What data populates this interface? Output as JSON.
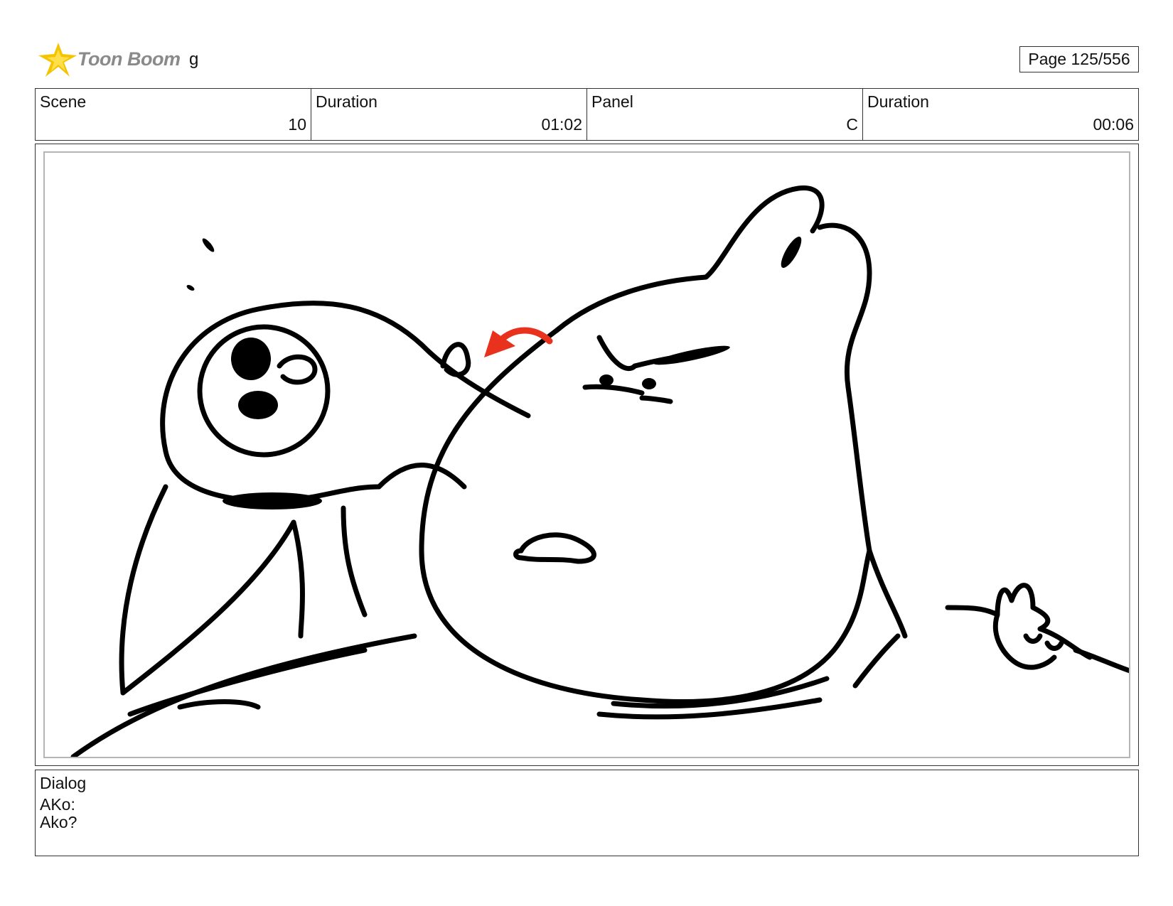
{
  "header": {
    "logo_text": "Toon Boom",
    "project_name": "g",
    "page_label": "Page 125/556"
  },
  "info": {
    "scene_label": "Scene",
    "scene_value": "10",
    "scene_duration_label": "Duration",
    "scene_duration_value": "01:02",
    "panel_label": "Panel",
    "panel_value": "C",
    "panel_duration_label": "Duration",
    "panel_duration_value": "00:06"
  },
  "dialog": {
    "label": "Dialog",
    "line1": "AKo:",
    "line2": "Ako?"
  },
  "colors": {
    "logo_star": "#f5c400",
    "arrow": "#e8321e",
    "ink": "#000000"
  }
}
